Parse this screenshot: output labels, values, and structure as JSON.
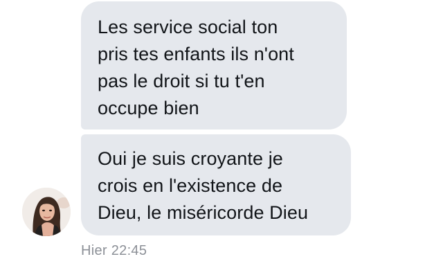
{
  "conversation": {
    "messages": [
      {
        "text": "Les service social ton\npris tes enfants ils n'ont\npas le droit si tu t'en\noccupe bien"
      },
      {
        "text": "Oui je suis croyante je\ncrois en l'existence de\nDieu, le miséricorde Dieu"
      }
    ],
    "timestamp": "Hier 22:45",
    "bubble_color": "#e5e8ed",
    "timestamp_color": "#8c9097"
  },
  "avatar": {
    "icon": "contact-avatar-photo"
  }
}
